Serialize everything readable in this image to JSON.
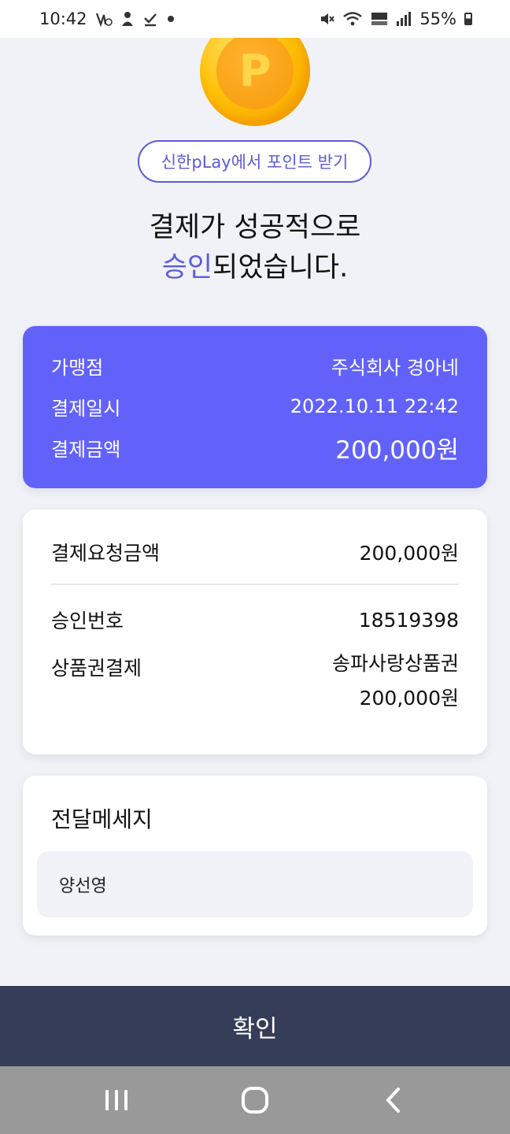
{
  "status_bar": {
    "time": "10:42",
    "battery": "55%"
  },
  "coin": {
    "letter": "P"
  },
  "pill_button": {
    "label": "신한pLay에서 포인트 받기"
  },
  "headline": {
    "line1": "결제가 성공적으로",
    "accent": "승인",
    "line2_rest": "되었습니다."
  },
  "summary": {
    "merchant_label": "가맹점",
    "merchant_value": "주식회사 경아네",
    "datetime_label": "결제일시",
    "datetime_value": "2022.10.11 22:42",
    "amount_label": "결제금액",
    "amount_value": "200,000원"
  },
  "detail": {
    "request_label": "결제요청금액",
    "request_value": "200,000원",
    "approval_label": "승인번호",
    "approval_value": "18519398",
    "voucher_label": "상품권결제",
    "voucher_name": "송파사랑상품권",
    "voucher_amount": "200,000원"
  },
  "message": {
    "title": "전달메세지",
    "value": "양선영"
  },
  "confirm_button": {
    "label": "확인"
  },
  "colors": {
    "accent": "#6262fb",
    "confirm_bg": "#363d58",
    "page_bg": "#f1f2f7"
  }
}
